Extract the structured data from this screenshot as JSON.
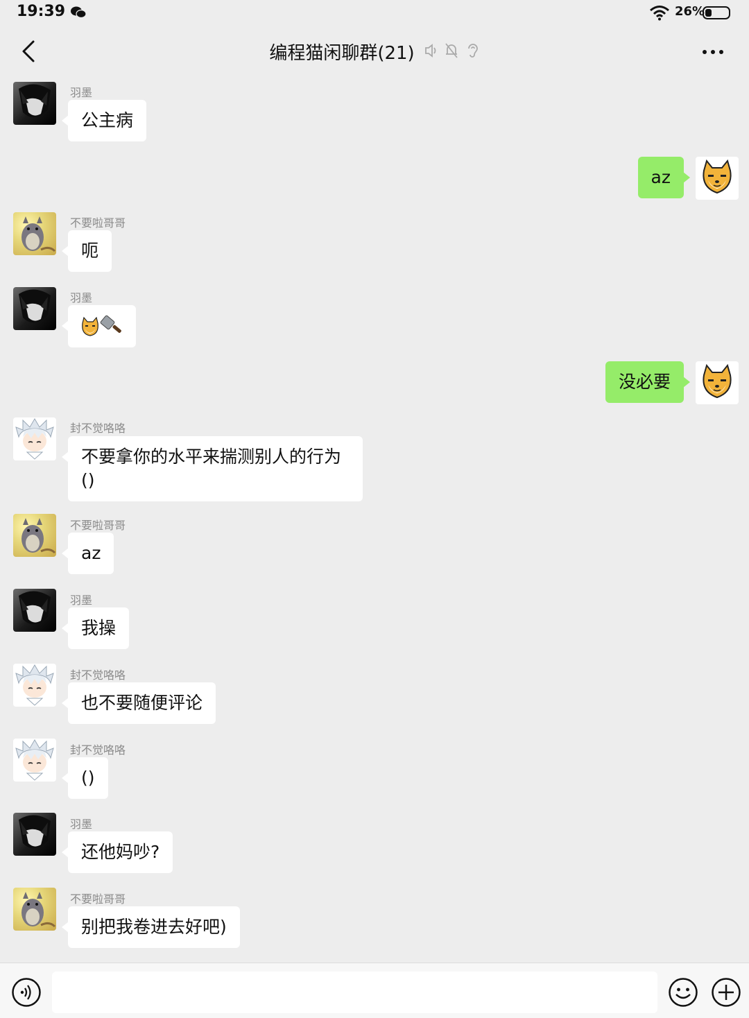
{
  "status_bar": {
    "time": "19:39",
    "battery": "26%"
  },
  "header": {
    "title": "编程猫闲聊群(21)"
  },
  "messages": [
    {
      "side": "left",
      "sender": "羽墨",
      "text": "公主病",
      "avatar": "dark-boy"
    },
    {
      "side": "right",
      "text": "az",
      "avatar": "shiba-dog"
    },
    {
      "side": "left",
      "sender": "不要啦哥哥",
      "text": "呃",
      "avatar": "totoro"
    },
    {
      "side": "left",
      "sender": "羽墨",
      "text": "",
      "emoji": "dog-and-cleaver",
      "avatar": "dark-boy"
    },
    {
      "side": "right",
      "text": "没必要",
      "avatar": "shiba-dog"
    },
    {
      "side": "left",
      "sender": "封不觉咯咯",
      "text": "不要拿你的水平来揣测别人的行为\n()",
      "avatar": "silver-hair"
    },
    {
      "side": "left",
      "sender": "不要啦哥哥",
      "text": "az",
      "avatar": "totoro"
    },
    {
      "side": "left",
      "sender": "羽墨",
      "text": "我操",
      "avatar": "dark-boy"
    },
    {
      "side": "left",
      "sender": "封不觉咯咯",
      "text": "也不要随便评论",
      "avatar": "silver-hair"
    },
    {
      "side": "left",
      "sender": "封不觉咯咯",
      "text": "()",
      "avatar": "silver-hair"
    },
    {
      "side": "left",
      "sender": "羽墨",
      "text": "还他妈吵?",
      "avatar": "dark-boy"
    },
    {
      "side": "left",
      "sender": "不要啦哥哥",
      "text": "别把我卷进去好吧)",
      "avatar": "totoro"
    }
  ],
  "input_bar": {
    "placeholder": ""
  },
  "colors": {
    "background": "#ededed",
    "bubble_self": "#95ec69",
    "bubble_other": "#ffffff"
  }
}
